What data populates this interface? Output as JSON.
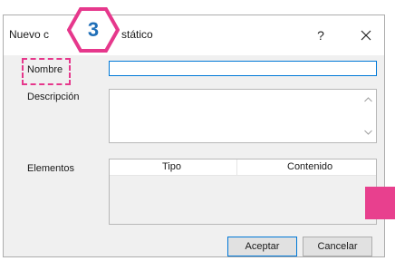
{
  "dialog": {
    "title_left": "Nuevo c",
    "title_right": "stático",
    "help_label": "?",
    "close_icon": "close-icon"
  },
  "fields": {
    "name_label": "Nombre",
    "name_value": "",
    "description_label": "Descripción",
    "description_value": "",
    "elements_label": "Elementos"
  },
  "table": {
    "columns": [
      "Tipo",
      "Contenido"
    ],
    "rows": []
  },
  "buttons": {
    "ok": "Aceptar",
    "cancel": "Cancelar"
  },
  "annotation": {
    "step_number": "3",
    "accent_color": "#e6388c",
    "number_color": "#1f6fb8"
  }
}
